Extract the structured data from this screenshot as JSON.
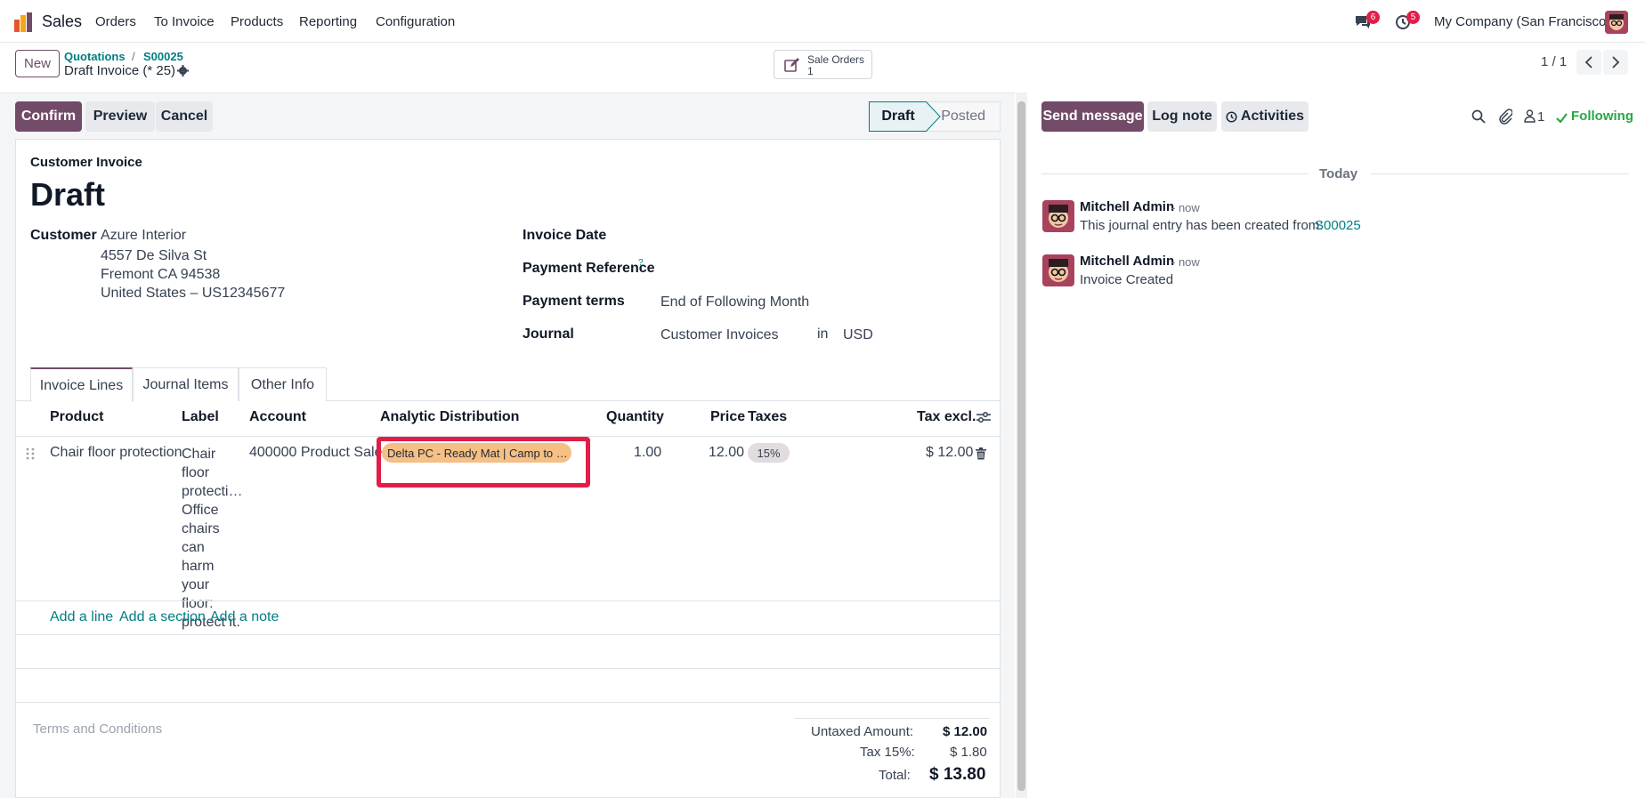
{
  "navbar": {
    "app_name": "Sales",
    "menu": [
      "Orders",
      "To Invoice",
      "Products",
      "Reporting",
      "Configuration"
    ],
    "messages_count": "6",
    "activities_count": "5",
    "company": "My Company (San Francisco)"
  },
  "control": {
    "new_label": "New",
    "breadcrumb_1": "Quotations",
    "breadcrumb_sep": "/",
    "breadcrumb_2": "S00025",
    "record_title": "Draft Invoice (* 25)",
    "smart_button_label": "Sale Orders",
    "smart_button_count": "1",
    "pager": "1 / 1"
  },
  "statusbar": {
    "confirm": "Confirm",
    "preview": "Preview",
    "cancel": "Cancel",
    "stage_draft": "Draft",
    "stage_posted": "Posted"
  },
  "form": {
    "type_label": "Customer Invoice",
    "state_title": "Draft",
    "customer_label": "Customer",
    "customer_name": "Azure Interior",
    "customer_addr1": "4557 De Silva St",
    "customer_addr2": "Fremont CA 94538",
    "customer_addr3": "United States – US12345677",
    "invoice_date_label": "Invoice Date",
    "payment_ref_label": "Payment Reference",
    "payment_ref_help": "?",
    "payment_terms_label": "Payment terms",
    "payment_terms_value": "End of Following Month",
    "journal_label": "Journal",
    "journal_value": "Customer Invoices",
    "journal_in": "in",
    "currency": "USD"
  },
  "tabs": [
    "Invoice Lines",
    "Journal Items",
    "Other Info"
  ],
  "lines": {
    "headers": {
      "product": "Product",
      "label": "Label",
      "account": "Account",
      "analytic": "Analytic Distribution",
      "quantity": "Quantity",
      "price": "Price",
      "taxes": "Taxes",
      "tax_excl": "Tax excl."
    },
    "row": {
      "product": "Chair floor protection",
      "label_lines": [
        "Chair",
        "floor",
        "protecti…",
        "Office",
        "chairs can",
        "harm your",
        "floor:",
        "protect it."
      ],
      "account": "400000 Product Sales",
      "analytic": "Delta PC - Ready Mat | Camp to …",
      "quantity": "1.00",
      "price": "12.00",
      "tax": "15%",
      "subtotal": "$ 12.00"
    },
    "add_line": "Add a line",
    "add_section": "Add a section",
    "add_note": "Add a note"
  },
  "footer": {
    "terms_placeholder": "Terms and Conditions",
    "untaxed_label": "Untaxed Amount:",
    "untaxed_value": "$ 12.00",
    "tax_label": "Tax 15%:",
    "tax_value": "$ 1.80",
    "total_label": "Total:",
    "total_value": "$ 13.80"
  },
  "chatter": {
    "send_message": "Send message",
    "log_note": "Log note",
    "activities": "Activities",
    "followers_count": "1",
    "following": "Following",
    "date_separator": "Today",
    "messages": [
      {
        "author": "Mitchell Admin",
        "time": "- now",
        "body": "This journal entry has been created from: ",
        "link": "S00025"
      },
      {
        "author": "Mitchell Admin",
        "time": "- now",
        "body": "Invoice Created",
        "link": ""
      }
    ]
  },
  "colors": {
    "brand": "#714b67",
    "link": "#017e84",
    "highlight": "#e11d48",
    "analytic_tag": "#f6bf84",
    "following": "#28a745"
  }
}
